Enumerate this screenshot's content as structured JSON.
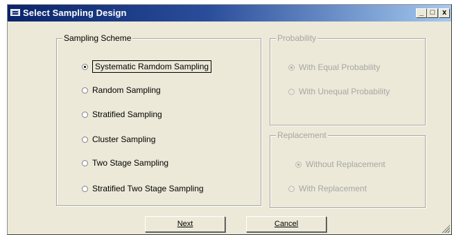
{
  "window": {
    "title": "Select Sampling Design",
    "minimize_glyph": "_",
    "maximize_glyph": "□",
    "close_glyph": "x"
  },
  "sampling_scheme": {
    "label": "Sampling Scheme",
    "selected": "Systematic Ramdom Sampling",
    "options": [
      {
        "label": "Systematic Ramdom Sampling",
        "checked": true
      },
      {
        "label": "Random Sampling",
        "checked": false
      },
      {
        "label": "Stratified Sampling",
        "checked": false
      },
      {
        "label": "Cluster Sampling",
        "checked": false
      },
      {
        "label": "Two Stage Sampling",
        "checked": false
      },
      {
        "label": "Stratified Two Stage Sampling",
        "checked": false
      }
    ]
  },
  "probability": {
    "label": "Probability",
    "enabled": false,
    "options": [
      {
        "label": "With Equal Probability",
        "checked": true
      },
      {
        "label": "With Unequal Probability",
        "checked": false
      }
    ]
  },
  "replacement": {
    "label": "Replacement",
    "enabled": false,
    "options": [
      {
        "label": "Without Replacement",
        "checked": true
      },
      {
        "label": "With Replacement",
        "checked": false
      }
    ]
  },
  "buttons": {
    "next_label": "Next",
    "cancel_label": "Cancel"
  },
  "colors": {
    "face": "#ece9d8",
    "titlebar_start": "#0a246a",
    "titlebar_end": "#a6caf0",
    "disabled_text": "#a6a6a6"
  }
}
